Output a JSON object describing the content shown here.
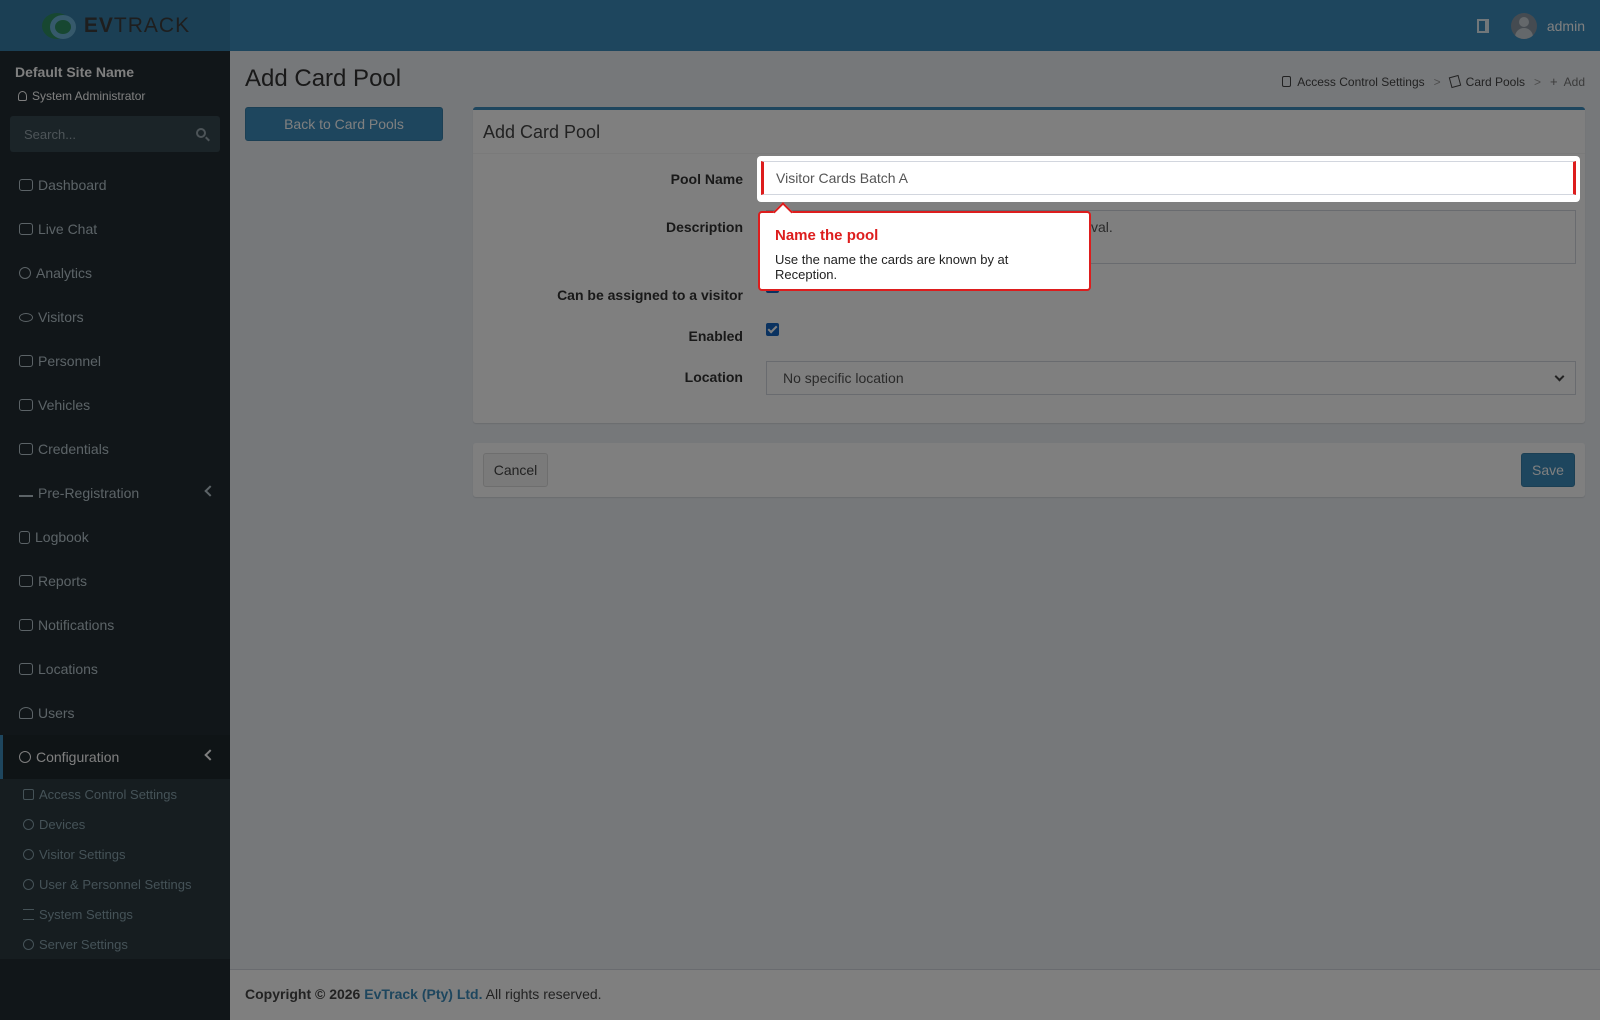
{
  "header": {
    "logo_ev": "EV",
    "logo_track": "TRACK",
    "username": "admin"
  },
  "sidebar": {
    "site_name": "Default Site Name",
    "role": "System Administrator",
    "search_placeholder": "Search...",
    "items": [
      {
        "label": "Dashboard",
        "icon": "dashboard-icon"
      },
      {
        "label": "Live Chat",
        "icon": "headset-icon"
      },
      {
        "label": "Analytics",
        "icon": "target-icon"
      },
      {
        "label": "Visitors",
        "icon": "eye-icon"
      },
      {
        "label": "Personnel",
        "icon": "person-gear-icon"
      },
      {
        "label": "Vehicles",
        "icon": "car-icon"
      },
      {
        "label": "Credentials",
        "icon": "id-card-icon"
      },
      {
        "label": "Pre-Registration",
        "icon": "arrows-icon"
      },
      {
        "label": "Logbook",
        "icon": "book-icon"
      },
      {
        "label": "Reports",
        "icon": "chart-icon"
      },
      {
        "label": "Notifications",
        "icon": "chat-icon"
      },
      {
        "label": "Locations",
        "icon": "map-icon"
      },
      {
        "label": "Users",
        "icon": "users-icon"
      },
      {
        "label": "Configuration",
        "icon": "gear-icon"
      }
    ],
    "subitems": [
      {
        "label": "Access Control Settings",
        "icon": "lock-icon"
      },
      {
        "label": "Devices",
        "icon": "gear-icon"
      },
      {
        "label": "Visitor Settings",
        "icon": "eye-icon"
      },
      {
        "label": "User & Personnel Settings",
        "icon": "users-icon"
      },
      {
        "label": "System Settings",
        "icon": "sliders-icon"
      },
      {
        "label": "Server Settings",
        "icon": "wrench-icon"
      }
    ]
  },
  "page": {
    "title": "Add Card Pool",
    "back_button": "Back to Card Pools",
    "breadcrumb": {
      "item1": "Access Control Settings",
      "item2": "Card Pools",
      "item3": "Add",
      "sep": ">"
    }
  },
  "form": {
    "box_title": "Add Card Pool",
    "pool_name_label": "Pool Name",
    "pool_name_value": "Visitor Cards Batch A",
    "description_label": "Description",
    "description_visible_tail": "val.",
    "assignable_label": "Can be assigned to a visitor",
    "enabled_label": "Enabled",
    "location_label": "Location",
    "location_value": "No specific location",
    "cancel": "Cancel",
    "save": "Save"
  },
  "tooltip": {
    "title": "Name the pool",
    "body": "Use the name the cards are known by at Reception."
  },
  "footer": {
    "copyright": "Copyright © 2026",
    "company": "EvTrack (Pty) Ltd.",
    "rights": "All rights reserved."
  },
  "colors": {
    "brand_blue": "#3c8dbc",
    "sidebar_dark": "#222d32",
    "highlight_red": "#dd1d1d"
  }
}
